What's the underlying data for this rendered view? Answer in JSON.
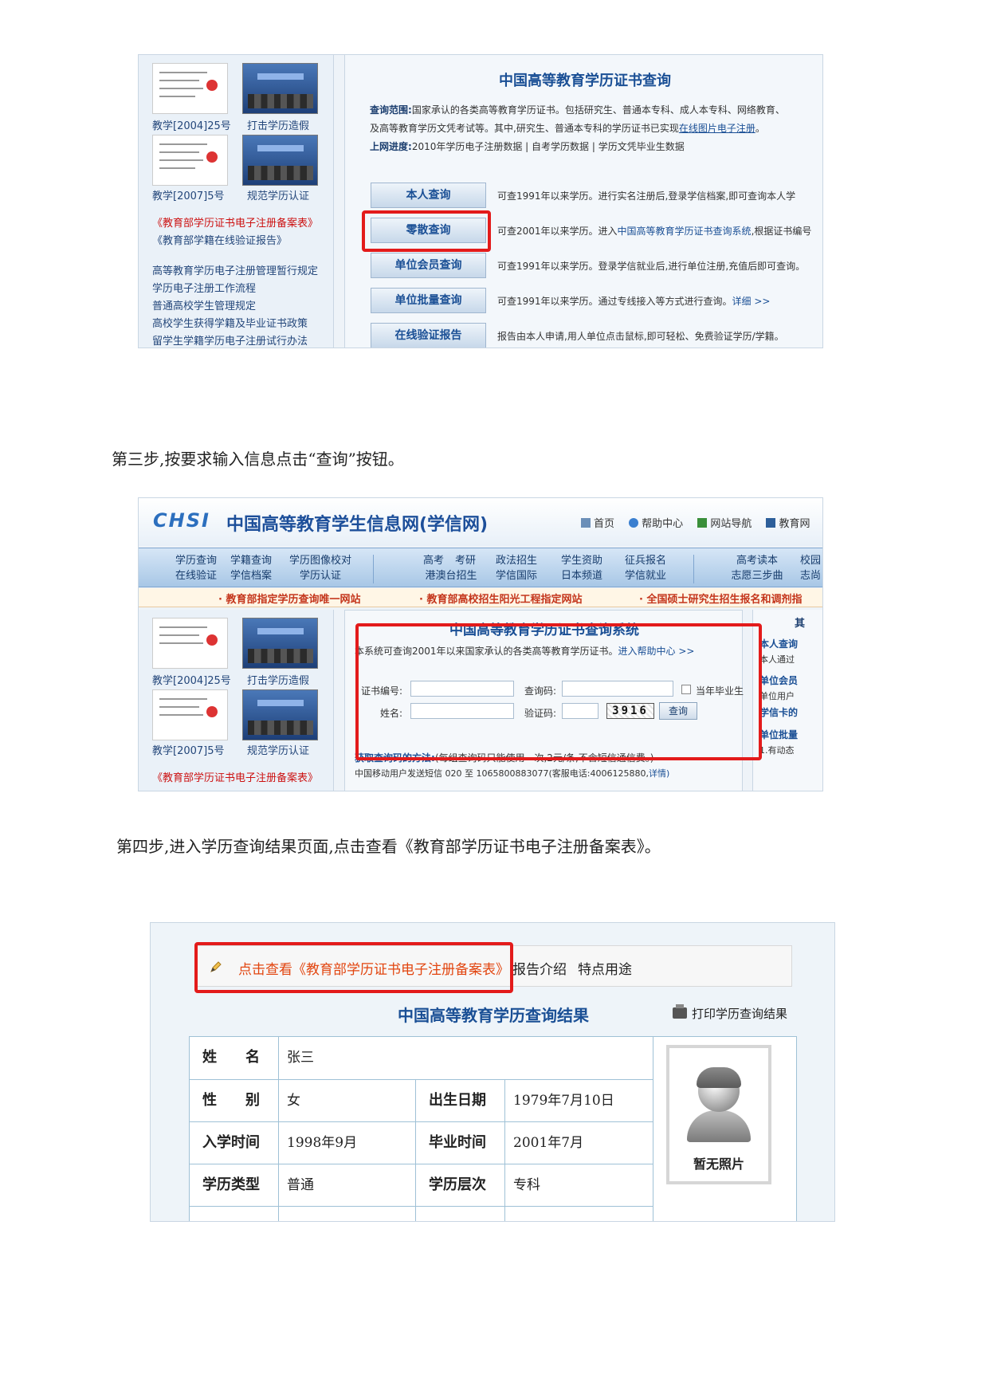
{
  "shot1": {
    "left_captions": [
      "教学[2004]25号",
      "打击学历造假",
      "教学[2007]5号",
      "规范学历认证"
    ],
    "left_red_links": [
      "《教育部学历证书电子注册备案表》",
      "《教育部学籍在线验证报告》"
    ],
    "left_links": [
      "高等教育学历电子注册管理暂行规定",
      "学历电子注册工作流程",
      "普通高校学生管理规定",
      "高校学生获得学籍及毕业证书政策",
      "留学生学籍学历电子注册试行办法"
    ],
    "title": "中国高等教育学历证书查询",
    "scope_label": "查询范围:",
    "scope_line1": "国家承认的各类高等教育学历证书。包括研究生、普通本专科、成人本专科、网络教育、",
    "scope_line2_pre": "及高等教育学历文凭考试等。其中,研究生、普通本专科的学历证书已实现",
    "scope_line2_link": "在线图片电子注册",
    "scope_line2_post": "。",
    "progress_label": "上网进度:",
    "progress_text": "2010年学历电子注册数据 | 自考学历数据 | 学历文凭毕业生数据",
    "query_buttons": [
      "本人查询",
      "零散查询",
      "单位会员查询",
      "单位批量查询",
      "在线验证报告"
    ],
    "query_desc_1": "可查1991年以来学历。进行实名注册后,登录学信档案,即可查询本人学",
    "query_desc_2_pre": "可查2001年以来学历。进入",
    "query_desc_2_link": "中国高等教育学历证书查询系统",
    "query_desc_2_post": ",根据证书编号",
    "query_desc_3": "可查1991年以来学历。登录学信就业后,进行单位注册,充值后即可查询。",
    "query_desc_4_pre": "可查1991年以来学历。通过专线接入等方式进行查询。",
    "query_desc_4_link": "详细 >>",
    "query_desc_5": "报告由本人申请,用人单位点击鼠标,即可轻松、免费验证学历/学籍。"
  },
  "step3": "第三步,按要求输入信息点击“查询”按钮。",
  "shot2": {
    "logo": "CHSI",
    "site_name": "中国高等教育学生信息网(学信网)",
    "top_links": [
      "首页",
      "帮助中心",
      "网站导航",
      "教育网"
    ],
    "nav_group1_row1": [
      "学历查询",
      "学籍查询",
      "学历图像校对"
    ],
    "nav_group1_row2": [
      "在线验证",
      "学信档案",
      "学历认证"
    ],
    "nav_group2_row1": [
      "高考",
      "考研",
      "政法招生",
      "学生资助",
      "征兵报名"
    ],
    "nav_group2_row2": [
      "港澳台招生",
      "学信国际",
      "日本频道",
      "学信就业"
    ],
    "nav_group3_row1": [
      "高考读本",
      "校园"
    ],
    "nav_group3_row2": [
      "志愿三步曲",
      "志尚"
    ],
    "slogans": [
      "· 教育部指定学历查询唯一网站",
      "· 教育部高校招生阳光工程指定网站",
      "· 全国硕士研究生招生报名和调剂指"
    ],
    "left_captions": [
      "教学[2004]25号",
      "打击学历造假",
      "教学[2007]5号",
      "规范学历认证"
    ],
    "left_red_link": "《教育部学历证书电子注册备案表》",
    "sys_title": "中国高等教育学历证书查询系统",
    "sys_desc": "本系统可查询2001年以来国家承认的各类高等教育学历证书。",
    "sys_help": "进入帮助中心 >>",
    "cert_label": "证书编号:",
    "code_label": "查询码:",
    "grad_label": "当年毕业生",
    "name_label": "姓名:",
    "verify_label": "验证码:",
    "captcha": "3916",
    "search_button": "查询",
    "howto_label": "获取查询码的方法:",
    "howto_text": "(每组查询码只能使用一次,2元/条,不含短信通信费。)",
    "sms_text": "中国移动用户发送短信 020 至 1065800883077(客服电话:4006125880,",
    "sms_link": "详情)",
    "right_head": "其",
    "right_items": [
      "本人查询",
      "单位会员",
      "学信卡的",
      "单位批量"
    ],
    "right_subs": [
      "本人通过",
      "单位用户",
      "1.有动态"
    ]
  },
  "step4": "第四步,进入学历查询结果页面,点击查看《教育部学历证书电子注册备案表》。",
  "shot3": {
    "record_link": "点击查看《教育部学历证书电子注册备案表》",
    "tab_report": "报告介绍",
    "tab_features": "特点用途",
    "title": "中国高等教育学历查询结果",
    "print": "打印学历查询结果",
    "name_key": "姓　　名",
    "name_val": "张三",
    "gender_key": "性　　别",
    "gender_val": "女",
    "birth_key": "出生日期",
    "birth_val": "1979年7月10日",
    "enroll_key": "入学时间",
    "enroll_val": "1998年9月",
    "grad_key": "毕业时间",
    "grad_val": "2001年7月",
    "type_key": "学历类型",
    "type_val": "普通",
    "level_key": "学历层次",
    "level_val": "专科",
    "photo_text": "暂无照片"
  }
}
